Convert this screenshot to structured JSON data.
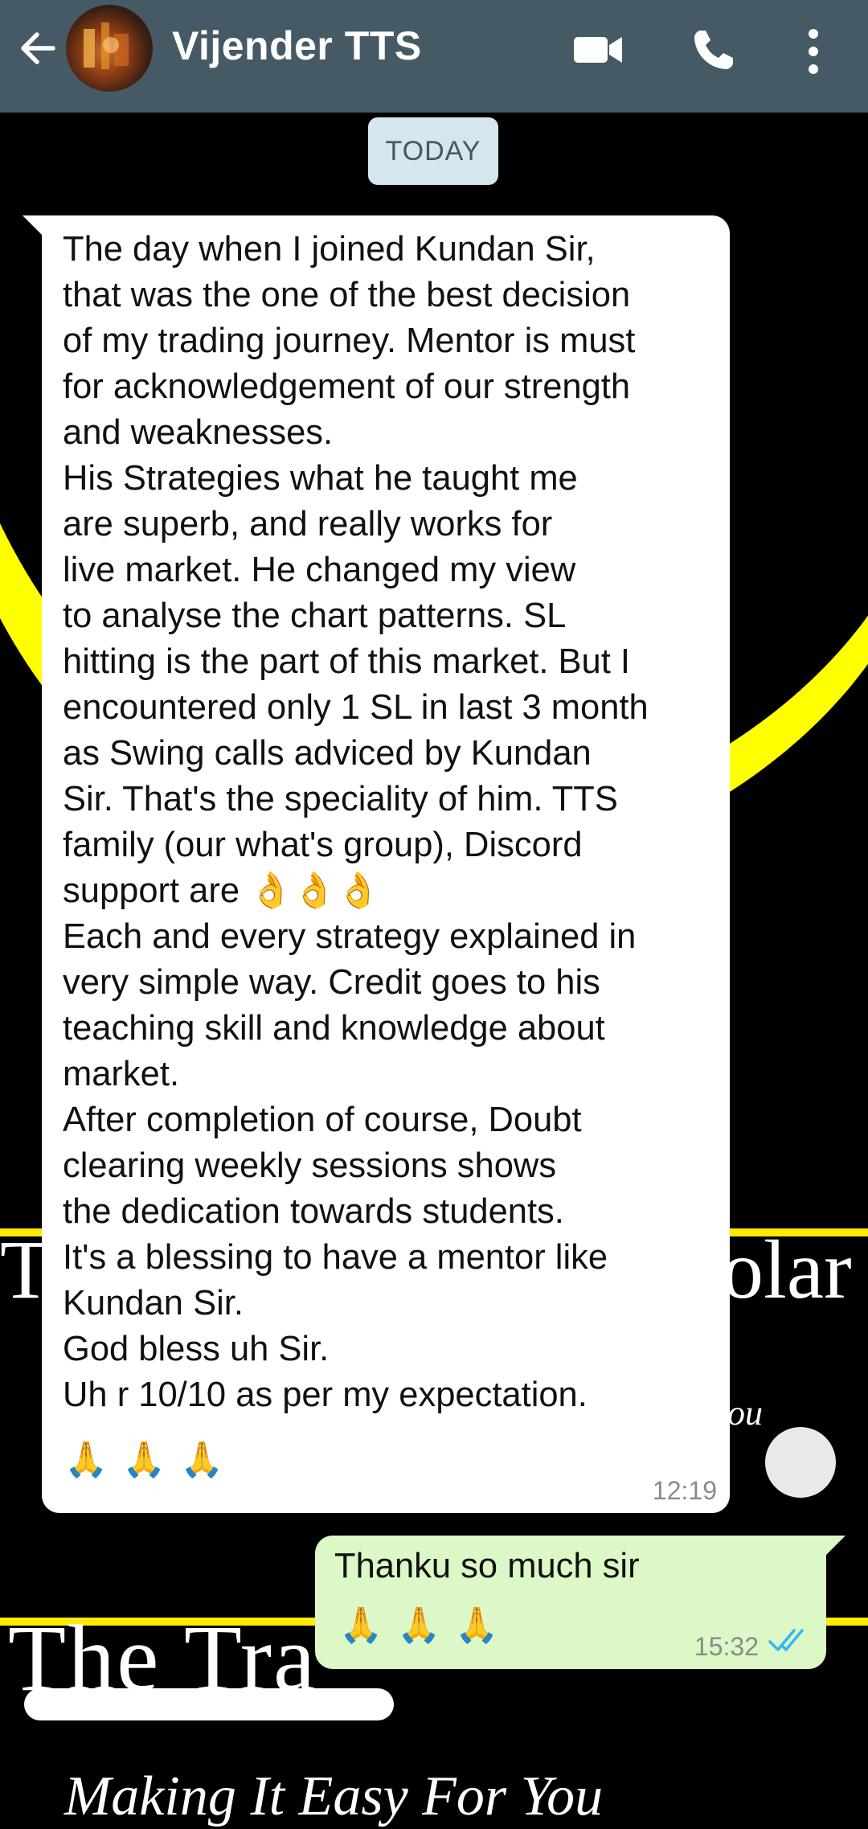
{
  "header": {
    "contact_name": "Vijender TTS",
    "background_color": "#455a64",
    "icons": [
      "back-arrow-icon",
      "video-call-icon",
      "voice-call-icon",
      "more-options-icon"
    ]
  },
  "wallpaper": {
    "text_1": "T",
    "text_2": "olar",
    "text_3": "The Tra",
    "text_4": "Making It Easy For You",
    "text_5": "ou",
    "accent_color": "#ffea00"
  },
  "chat": {
    "date_label": "TODAY",
    "messages": [
      {
        "direction": "incoming",
        "text": "The day when I joined Kundan Sir,\nthat was the one of the best decision\nof my trading journey. Mentor is must\nfor acknowledgement of our strength\nand weaknesses.\nHis Strategies what he taught me\nare superb, and really works for\nlive market. He changed my view\nto analyse the chart patterns. SL\nhitting is the part of this market. But I\nencountered only 1 SL in last 3 month\nas Swing calls adviced by Kundan\nSir. That's the speciality of him. TTS\nfamily (our what's group), Discord\nsupport are 👌👌👌\nEach and every strategy explained in\nvery simple way. Credit goes to his\nteaching skill and knowledge about\nmarket.\nAfter completion of course, Doubt\nclearing weekly sessions shows\nthe dedication towards students.\nIt's a blessing to have a mentor like\nKundan Sir.\nGod bless uh Sir.\nUh r 10/10 as per my expectation.",
        "emoji_row": [
          "🙏",
          "🙏",
          "🙏"
        ],
        "time": "12:19"
      },
      {
        "direction": "outgoing",
        "text": "Thanku so much sir",
        "emoji_row": [
          "🙏",
          "🙏",
          "🙏"
        ],
        "time": "15:32",
        "status": "read",
        "status_color": "#34b7f1"
      }
    ]
  }
}
